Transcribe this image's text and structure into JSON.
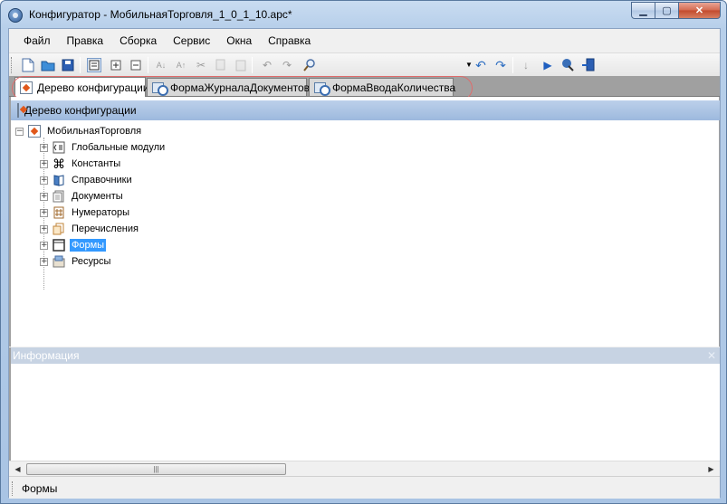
{
  "window": {
    "title": "Конфигуратор - МобильнаяТорговля_1_0_1_10.apc*",
    "min_icon": "minimize-icon",
    "max_icon": "maximize-icon",
    "close_icon": "close-icon"
  },
  "menu": {
    "items": [
      "Файл",
      "Правка",
      "Сборка",
      "Сервис",
      "Окна",
      "Справка"
    ]
  },
  "toolbar": {
    "icons": [
      "new-document-icon",
      "open-folder-icon",
      "save-icon",
      "tree-view-icon",
      "expand-icon",
      "collapse-icon",
      "sort-asc-icon",
      "sort-desc-icon",
      "cut-icon",
      "copy-icon",
      "paste-icon",
      "undo-icon",
      "redo-icon",
      "search-icon",
      "dropdown-icon",
      "back-icon",
      "forward-icon",
      "step-icon",
      "run-icon",
      "debug-icon",
      "deploy-icon"
    ]
  },
  "tabs": [
    {
      "label": "Дерево конфигурации",
      "icon": "config-tree-icon",
      "active": true
    },
    {
      "label": "ФормаЖурналаДокументов",
      "icon": "form-icon",
      "active": false
    },
    {
      "label": "ФормаВводаКоличества",
      "icon": "form-icon",
      "active": false
    }
  ],
  "tree": {
    "header": "Дерево конфигурации",
    "root": "МобильнаяТорговля",
    "nodes": [
      {
        "label": "Глобальные модули",
        "icon": "module-icon"
      },
      {
        "label": "Константы",
        "icon": "constants-icon"
      },
      {
        "label": "Справочники",
        "icon": "catalog-icon"
      },
      {
        "label": "Документы",
        "icon": "documents-icon"
      },
      {
        "label": "Нумераторы",
        "icon": "numerators-icon"
      },
      {
        "label": "Перечисления",
        "icon": "enums-icon"
      },
      {
        "label": "Формы",
        "icon": "forms-icon",
        "selected": true
      },
      {
        "label": "Ресурсы",
        "icon": "resources-icon"
      }
    ]
  },
  "info": {
    "header": "Информация"
  },
  "status": {
    "text": "Формы"
  },
  "colors": {
    "selection": "#3399ff",
    "panel_header": "#a9c1e2",
    "annotation": "#e06b6b"
  }
}
